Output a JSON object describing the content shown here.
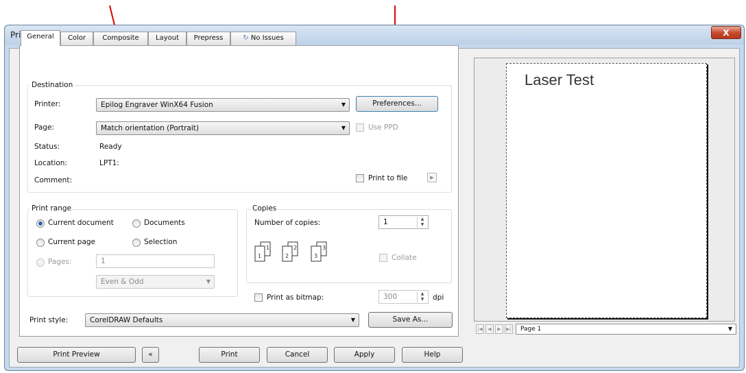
{
  "window": {
    "title": "Print",
    "close_label": "X"
  },
  "tabs": [
    "General",
    "Color",
    "Composite",
    "Layout",
    "Prepress",
    "No Issues"
  ],
  "destination": {
    "group_title": "Destination",
    "printer_label": "Printer:",
    "printer_value": "Epilog Engraver WinX64 Fusion",
    "preferences_button": "Preferences...",
    "page_label": "Page:",
    "page_value": "Match orientation (Portrait)",
    "use_ppd_label": "Use PPD",
    "status_label": "Status:",
    "status_value": "Ready",
    "location_label": "Location:",
    "location_value": "LPT1:",
    "comment_label": "Comment:",
    "print_to_file_label": "Print to file"
  },
  "print_range": {
    "group_title": "Print range",
    "current_document": "Current document",
    "documents": "Documents",
    "current_page": "Current page",
    "selection": "Selection",
    "pages_label": "Pages:",
    "pages_value": "1",
    "even_odd_value": "Even & Odd"
  },
  "copies": {
    "group_title": "Copies",
    "number_label": "Number of copies:",
    "number_value": "1",
    "collate_label": "Collate"
  },
  "bitmap": {
    "label": "Print as bitmap:",
    "dpi_value": "300",
    "dpi_unit": "dpi"
  },
  "print_style": {
    "label": "Print style:",
    "value": "CorelDRAW Defaults",
    "save_as_button": "Save As..."
  },
  "footer": {
    "print_preview_button": "Print Preview",
    "collapse_button": "«",
    "print_button": "Print",
    "cancel_button": "Cancel",
    "apply_button": "Apply",
    "help_button": "Help"
  },
  "preview": {
    "page_text": "Laser Test",
    "page_selector_value": "Page 1"
  },
  "colors": {
    "arrow": "#e00000",
    "radio_selected": "#2a62b8"
  }
}
